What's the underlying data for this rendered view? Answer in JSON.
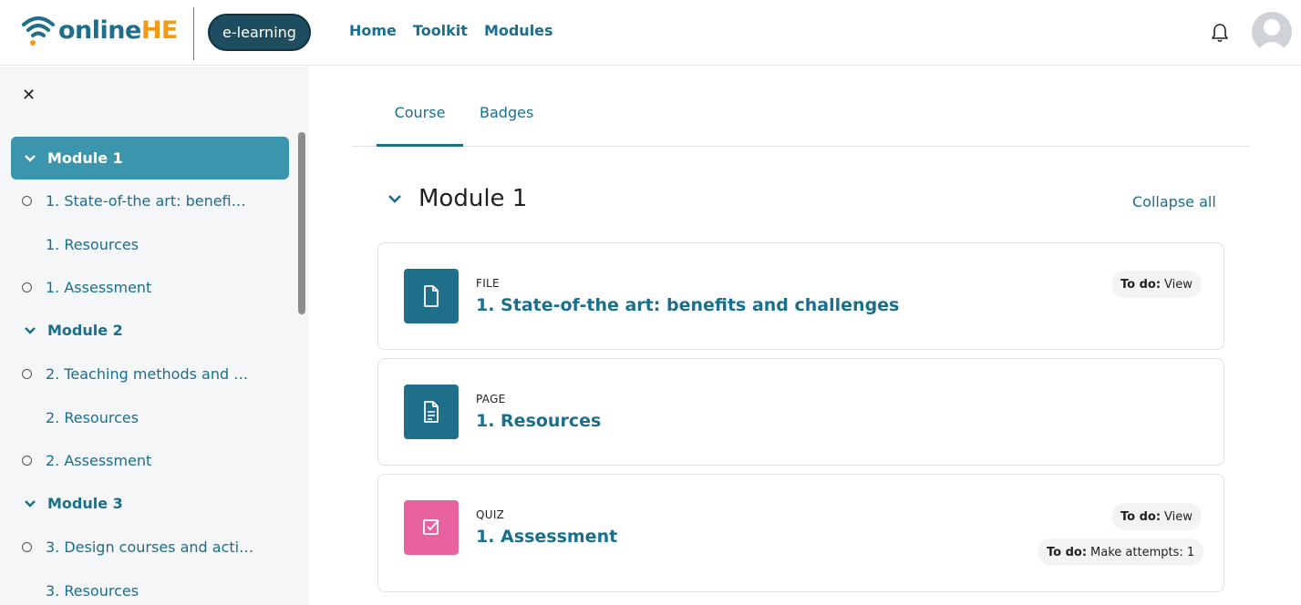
{
  "header": {
    "logo_prefix": "online",
    "logo_suffix": "HE",
    "pill_label": "e-learning",
    "nav": [
      "Home",
      "Toolkit",
      "Modules"
    ],
    "icons": {
      "bell": "bell-icon",
      "avatar": "user-avatar"
    }
  },
  "course_index": {
    "close_icon": "close-icon",
    "items": [
      {
        "kind": "section",
        "label": "Module 1",
        "active": true
      },
      {
        "kind": "activity",
        "label": "1. State-of-the art: benefi…",
        "circle": true
      },
      {
        "kind": "activity",
        "label": "1. Resources",
        "circle": false
      },
      {
        "kind": "activity",
        "label": "1. Assessment",
        "circle": true
      },
      {
        "kind": "section",
        "label": "Module 2",
        "active": false
      },
      {
        "kind": "activity",
        "label": "2. Teaching methods and …",
        "circle": true
      },
      {
        "kind": "activity",
        "label": "2. Resources",
        "circle": false
      },
      {
        "kind": "activity",
        "label": "2. Assessment",
        "circle": true
      },
      {
        "kind": "section",
        "label": "Module 3",
        "active": false
      },
      {
        "kind": "activity",
        "label": "3. Design courses and acti…",
        "circle": true
      },
      {
        "kind": "activity",
        "label": "3. Resources",
        "circle": false
      }
    ]
  },
  "tabs": [
    {
      "label": "Course",
      "active": true
    },
    {
      "label": "Badges",
      "active": false
    }
  ],
  "section": {
    "title": "Module 1",
    "collapse_all": "Collapse all"
  },
  "activities": [
    {
      "type": "FILE",
      "name": "1. State-of-the art: benefits and challenges",
      "icon": "file-icon",
      "color": "#1f6f8b",
      "todos": [
        {
          "label": "To do:",
          "value": "View"
        }
      ]
    },
    {
      "type": "PAGE",
      "name": "1. Resources",
      "icon": "page-icon",
      "color": "#1f6f8b",
      "todos": []
    },
    {
      "type": "QUIZ",
      "name": "1. Assessment",
      "icon": "quiz-icon",
      "color": "#e8629f",
      "todos": [
        {
          "label": "To do:",
          "value": "View"
        },
        {
          "label": "To do:",
          "value": "Make attempts: 1"
        }
      ]
    }
  ]
}
